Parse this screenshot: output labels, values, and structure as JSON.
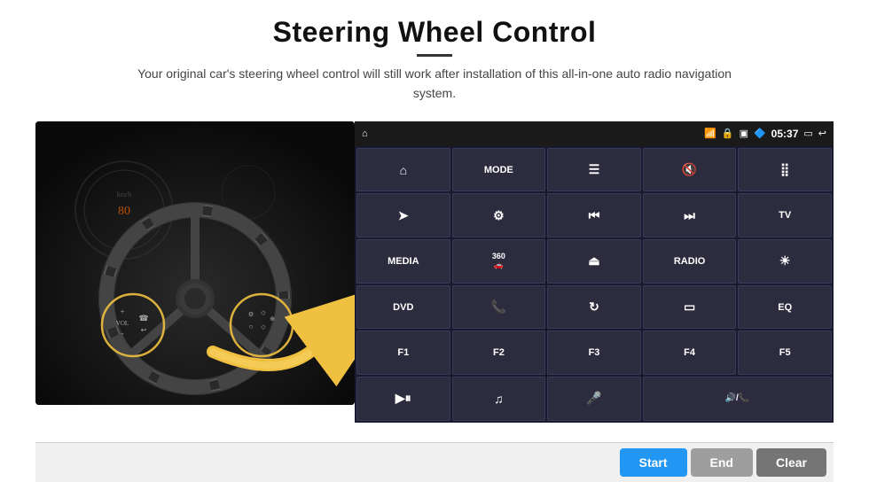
{
  "header": {
    "title": "Steering Wheel Control",
    "subtitle": "Your original car's steering wheel control will still work after installation of this all-in-one auto radio navigation system."
  },
  "status_bar": {
    "time": "05:37",
    "icons": [
      "wifi",
      "lock",
      "sim",
      "bluetooth",
      "screen",
      "back"
    ]
  },
  "grid_buttons": [
    {
      "id": "nav",
      "label": "▲",
      "type": "icon"
    },
    {
      "id": "mode",
      "label": "MODE",
      "type": "text"
    },
    {
      "id": "list",
      "label": "☰",
      "type": "icon"
    },
    {
      "id": "mute",
      "label": "🔇",
      "type": "icon"
    },
    {
      "id": "apps",
      "label": "⋯",
      "type": "icon"
    },
    {
      "id": "send",
      "label": "➤",
      "type": "icon"
    },
    {
      "id": "settings",
      "label": "⚙",
      "type": "icon"
    },
    {
      "id": "prev",
      "label": "⏮",
      "type": "icon"
    },
    {
      "id": "next",
      "label": "⏭",
      "type": "icon"
    },
    {
      "id": "tv",
      "label": "TV",
      "type": "text"
    },
    {
      "id": "media",
      "label": "MEDIA",
      "type": "text"
    },
    {
      "id": "cam360",
      "label": "360",
      "type": "text"
    },
    {
      "id": "eject",
      "label": "⏏",
      "type": "icon"
    },
    {
      "id": "radio",
      "label": "RADIO",
      "type": "text"
    },
    {
      "id": "brightness",
      "label": "☀",
      "type": "icon"
    },
    {
      "id": "dvd",
      "label": "DVD",
      "type": "text"
    },
    {
      "id": "phone",
      "label": "📞",
      "type": "icon"
    },
    {
      "id": "rotate",
      "label": "↻",
      "type": "icon"
    },
    {
      "id": "display",
      "label": "▭",
      "type": "icon"
    },
    {
      "id": "eq",
      "label": "EQ",
      "type": "text"
    },
    {
      "id": "f1",
      "label": "F1",
      "type": "text"
    },
    {
      "id": "f2",
      "label": "F2",
      "type": "text"
    },
    {
      "id": "f3",
      "label": "F3",
      "type": "text"
    },
    {
      "id": "f4",
      "label": "F4",
      "type": "text"
    },
    {
      "id": "f5",
      "label": "F5",
      "type": "text"
    },
    {
      "id": "playpause",
      "label": "▶⏸",
      "type": "icon"
    },
    {
      "id": "music",
      "label": "♫",
      "type": "icon"
    },
    {
      "id": "mic",
      "label": "🎤",
      "type": "icon"
    },
    {
      "id": "volphone",
      "label": "🔊/📞",
      "type": "icon"
    }
  ],
  "action_buttons": {
    "start": "Start",
    "end": "End",
    "clear": "Clear"
  }
}
